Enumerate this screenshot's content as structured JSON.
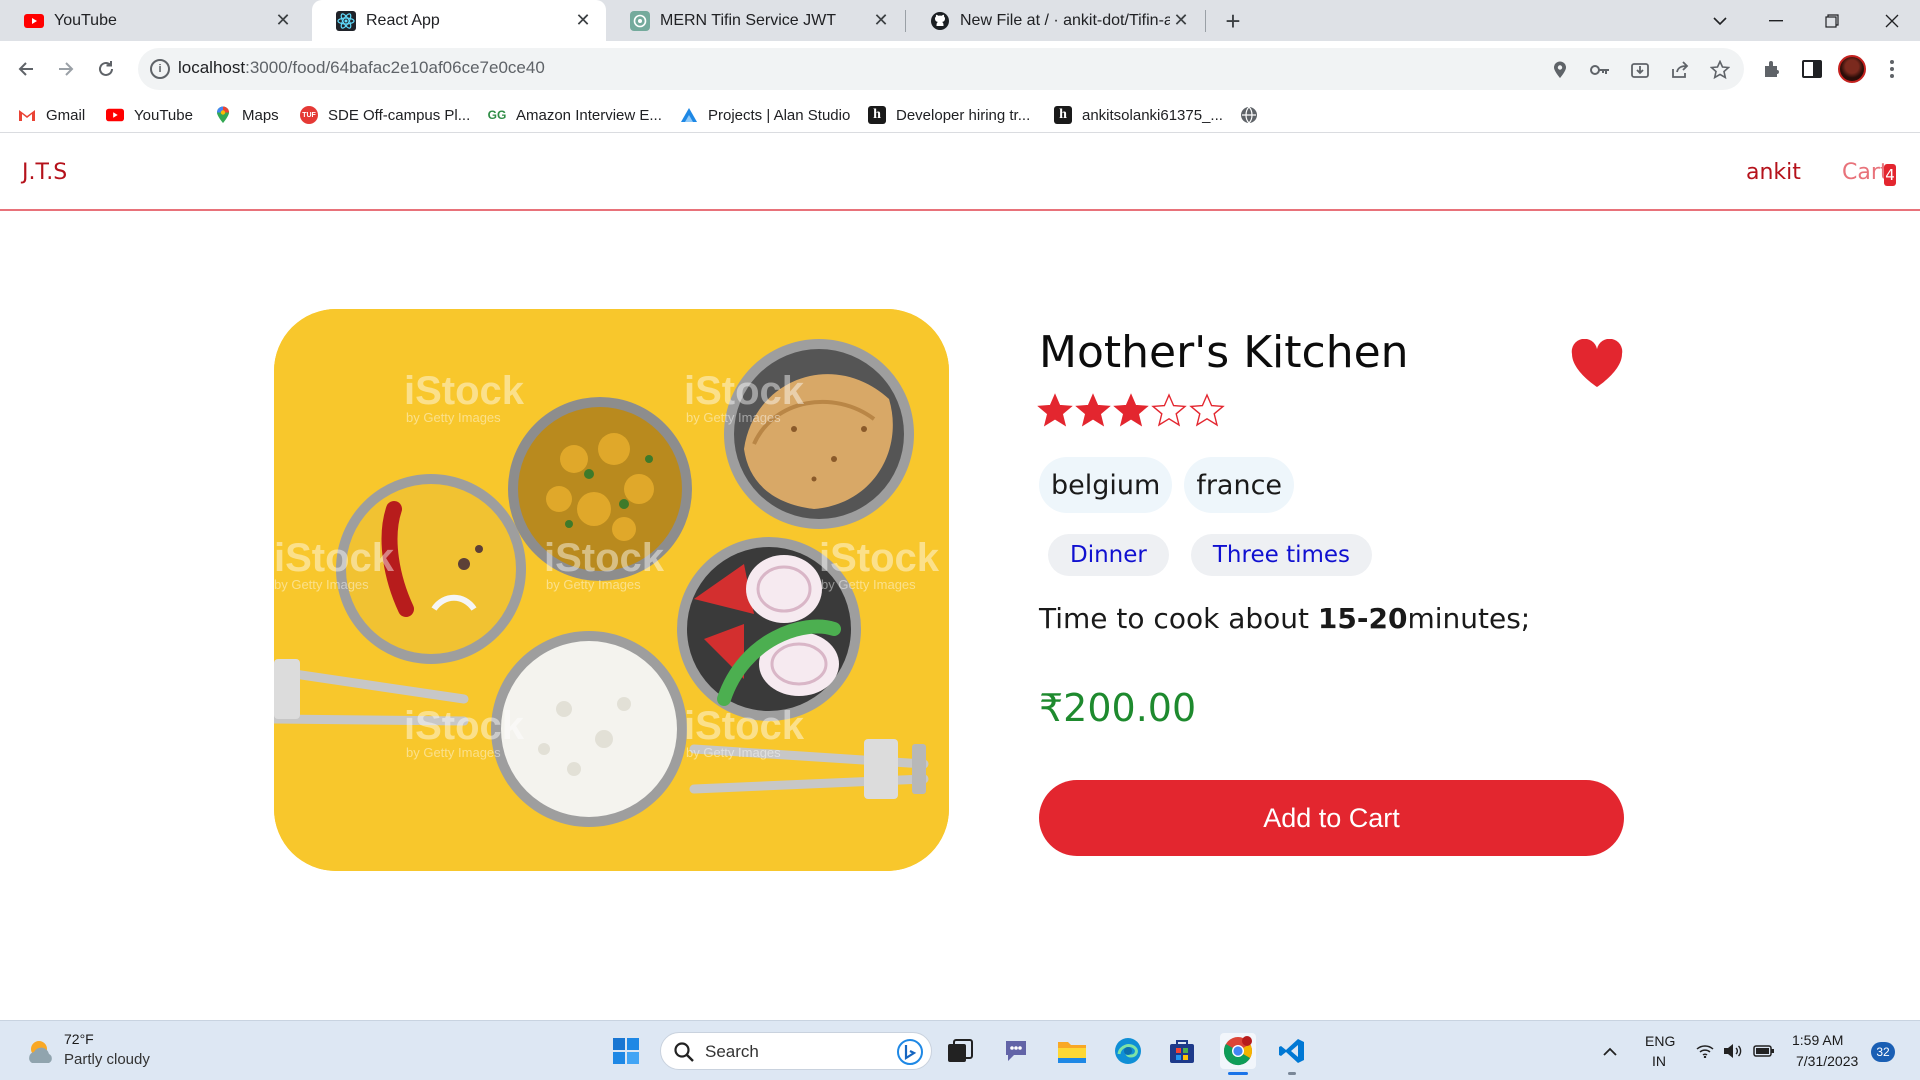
{
  "browser": {
    "tabs": [
      {
        "label": "YouTube",
        "icon": "youtube-icon",
        "active": false
      },
      {
        "label": "React App",
        "icon": "react-icon",
        "active": true
      },
      {
        "label": "MERN Tifin Service JWT",
        "icon": "chatgpt-icon",
        "active": false
      },
      {
        "label": "New File at / · ankit-dot/Tifin-app",
        "icon": "github-icon",
        "active": false
      }
    ],
    "url_host": "localhost",
    "url_path": ":3000/food/64bafac2e10af06ce7e0ce40",
    "bookmarks": [
      {
        "label": "Gmail",
        "icon": "gmail-icon"
      },
      {
        "label": "YouTube",
        "icon": "youtube-icon"
      },
      {
        "label": "Maps",
        "icon": "maps-icon"
      },
      {
        "label": "SDE Off-campus Pl...",
        "icon": "tuf-icon"
      },
      {
        "label": "Amazon Interview E...",
        "icon": "gfg-icon"
      },
      {
        "label": "Projects | Alan Studio",
        "icon": "alan-icon"
      },
      {
        "label": "Developer hiring tr...",
        "icon": "hackerrank-icon"
      },
      {
        "label": "ankitsolanki61375_...",
        "icon": "hackerrank-icon"
      }
    ]
  },
  "app": {
    "brand": "J.T.S",
    "user": "ankit",
    "cart_label": "Cart",
    "cart_count": "4"
  },
  "food": {
    "name": "Mother's Kitchen",
    "rating": 3,
    "rating_max": 5,
    "favorite": true,
    "origins": [
      "belgium",
      "france"
    ],
    "tags": [
      "Dinner",
      "Three times"
    ],
    "cook_time_prefix": "Time to cook about ",
    "cook_time": "15-20",
    "cook_time_suffix": "minutes;",
    "price": "₹200.00",
    "add_to_cart_label": "Add to Cart",
    "image_watermark": "iStock",
    "image_watermark_sub": "by Getty Images"
  },
  "taskbar": {
    "weather_temp": "72°F",
    "weather_desc": "Partly cloudy",
    "search_placeholder": "Search",
    "lang_line1": "ENG",
    "lang_line2": "IN",
    "time": "1:59 AM",
    "date": "7/31/2023",
    "notifications": "32"
  },
  "colors": {
    "brand_red": "#e3262f",
    "price_green": "#1e8a2e",
    "tag_blue": "#1010d0",
    "image_bg": "#f8c72c"
  }
}
